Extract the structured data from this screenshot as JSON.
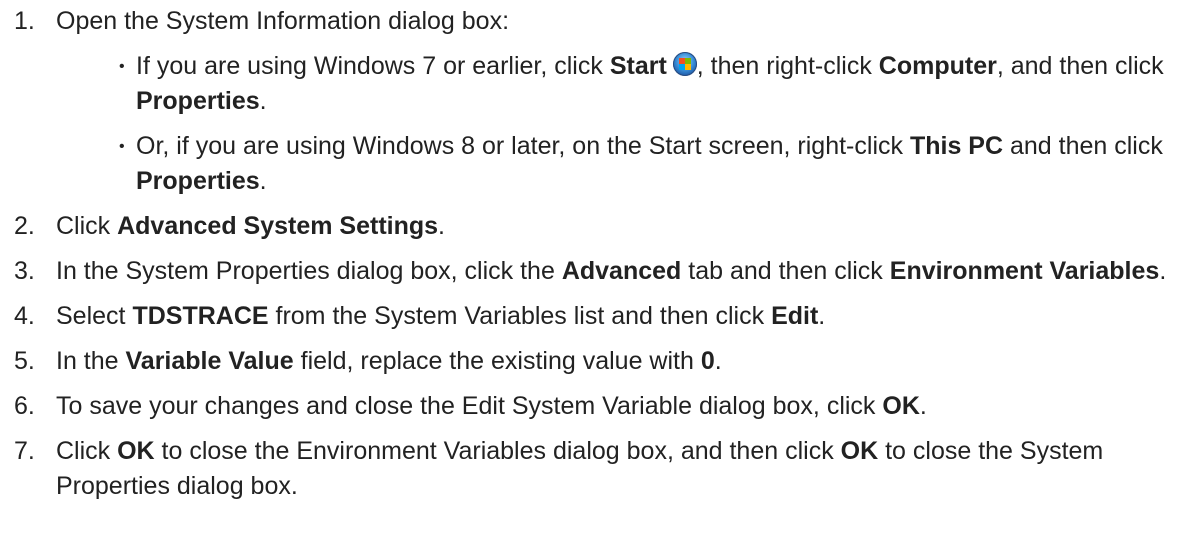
{
  "steps": [
    {
      "number": "1.",
      "text": "Open the System Information dialog box:",
      "sub_items": [
        {
          "bullet": "•",
          "t1": "If you are using Windows 7 or earlier, click ",
          "b1": "Start",
          "icon": "windows-start-orb-icon",
          "t2": ", then right-click ",
          "b2": "Computer",
          "t3": ", and then click ",
          "b3": "Properties",
          "t4": "."
        },
        {
          "bullet": "•",
          "t1": "Or, if you are using Windows 8 or later, on the Start screen, right-click ",
          "b1": "This PC",
          "t2": " and then click ",
          "b2": "Properties",
          "t3": "."
        }
      ]
    },
    {
      "number": "2.",
      "t1": "Click ",
      "b1": "Advanced System Settings",
      "t2": "."
    },
    {
      "number": "3.",
      "t1": "In the System Properties dialog box, click the ",
      "b1": "Advanced",
      "t2": " tab and then click ",
      "b2": "Environment Variables",
      "t3": "."
    },
    {
      "number": "4.",
      "t1": "Select ",
      "b1": "TDSTRACE",
      "t2": " from the System Variables list and then click ",
      "b2": "Edit",
      "t3": "."
    },
    {
      "number": "5.",
      "t1": "In the ",
      "b1": "Variable Value",
      "t2": " field, replace the existing value with ",
      "b2": "0",
      "t3": "."
    },
    {
      "number": "6.",
      "t1": "To save your changes and close the Edit System Variable dialog box, click ",
      "b1": "OK",
      "t2": "."
    },
    {
      "number": "7.",
      "t1": "Click ",
      "b1": "OK",
      "t2": " to close the Environment Variables dialog box, and then click ",
      "b2": "OK",
      "t3": " to close the System Properties dialog box."
    }
  ]
}
